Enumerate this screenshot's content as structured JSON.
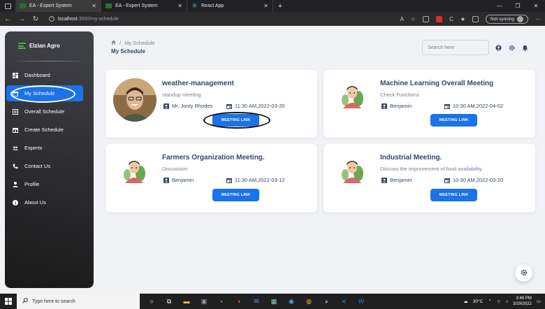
{
  "browser": {
    "tabs": [
      {
        "label": "EA - Expert System",
        "icon": "app-favicon",
        "active": true
      },
      {
        "label": "EA - Expert System",
        "icon": "app-favicon",
        "active": false
      },
      {
        "label": "React App",
        "icon": "react-icon",
        "active": false
      }
    ],
    "url_host": "localhost",
    "url_path": ":3000/my-schedule",
    "sync_label": "Not syncing"
  },
  "sidebar": {
    "brand": "Elzian Agro",
    "items": [
      {
        "label": "Dashboard",
        "icon": "dashboard-icon"
      },
      {
        "label": "My Schedule",
        "icon": "calendar-icon",
        "active": true
      },
      {
        "label": "Overall Schedule",
        "icon": "list-icon"
      },
      {
        "label": "Create Schedule",
        "icon": "calendar-add-icon"
      },
      {
        "label": "Experts",
        "icon": "group-icon"
      },
      {
        "label": "Contact Us",
        "icon": "phone-icon"
      },
      {
        "label": "Profile",
        "icon": "person-icon"
      },
      {
        "label": "About Us",
        "icon": "info-icon"
      }
    ]
  },
  "header": {
    "breadcrumb_current": "My Schedule",
    "page_title": "My Schedule",
    "search_placeholder": "Search here"
  },
  "meetings": [
    {
      "title": "weather-management",
      "subtitle": "standup meeting",
      "expert": "Mr. Jonty Rhodes",
      "datetime": "11:30 AM,2022-03-20",
      "button": "MEETING LINK",
      "avatar": "photo"
    },
    {
      "title": "Machine Learning Overall Meeting",
      "subtitle": "Check Functions",
      "expert": "Benjamin",
      "datetime": "10:30 AM,2022-04-02",
      "button": "MEETING LINK",
      "avatar": "illustration"
    },
    {
      "title": "Farmers Organization Meeting.",
      "subtitle": "Discussion",
      "expert": "Benjamin",
      "datetime": "11:30 AM,2022-03-12",
      "button": "MEETING LINK",
      "avatar": "illustration"
    },
    {
      "title": "Industrial Meeting.",
      "subtitle": "Discuss the improvement of food availability",
      "expert": "Benjamin",
      "datetime": "10:30 AM,2022-03-20",
      "button": "MEETING LINK",
      "avatar": "illustration"
    }
  ],
  "taskbar": {
    "search_placeholder": "Type here to search",
    "weather": "30°C",
    "time": "3:46 PM",
    "date": "3/29/2022"
  },
  "colors": {
    "accent": "#1a73e8",
    "sidebar_bg": "#191919",
    "page_bg": "#f0f2f5",
    "title": "#344767"
  }
}
